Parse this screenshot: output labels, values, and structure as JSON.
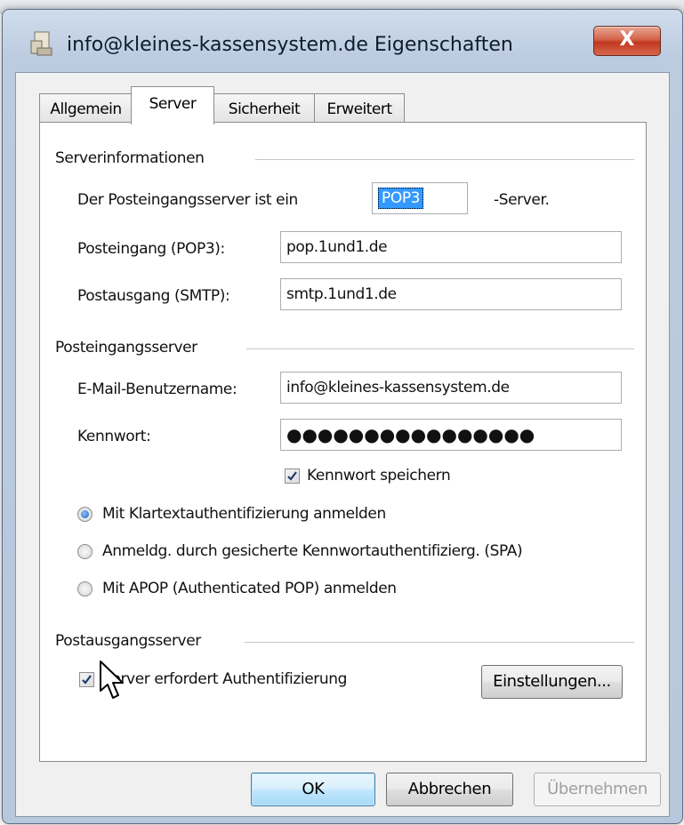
{
  "window": {
    "title": "info@kleines-kassensystem.de Eigenschaften",
    "close_label": "X"
  },
  "tabs": [
    {
      "label": "Allgemein",
      "active": false
    },
    {
      "label": "Server",
      "active": true
    },
    {
      "label": "Sicherheit",
      "active": false
    },
    {
      "label": "Erweitert",
      "active": false
    }
  ],
  "serverinfo": {
    "group_label": "Serverinformationen",
    "incoming_type_prefix": "Der Posteingangsserver ist ein",
    "incoming_type_value": "POP3",
    "incoming_type_suffix": "-Server.",
    "incoming_label": "Posteingang (POP3):",
    "incoming_value": "pop.1und1.de",
    "outgoing_label": "Postausgang (SMTP):",
    "outgoing_value": "smtp.1und1.de"
  },
  "incoming_server": {
    "group_label": "Posteingangsserver",
    "username_label": "E-Mail-Benutzername:",
    "username_value": "info@kleines-kassensystem.de",
    "password_label": "Kennwort:",
    "password_value": "●●●●●●●●●●●●●●●●",
    "save_password_label": "Kennwort speichern",
    "save_password_checked": true,
    "auth_options": [
      {
        "label": "Mit Klartextauthentifizierung anmelden",
        "checked": true
      },
      {
        "label": "Anmeldg. durch gesicherte Kennwortauthentifizierg. (SPA)",
        "checked": false
      },
      {
        "label": "Mit APOP (Authenticated POP) anmelden",
        "checked": false
      }
    ]
  },
  "outgoing_server": {
    "group_label": "Postausgangsserver",
    "requires_auth_label": "Server erfordert Authentifizierung",
    "requires_auth_checked": true,
    "settings_button": "Einstellungen..."
  },
  "buttons": {
    "ok": "OK",
    "cancel": "Abbrechen",
    "apply": "Übernehmen"
  }
}
